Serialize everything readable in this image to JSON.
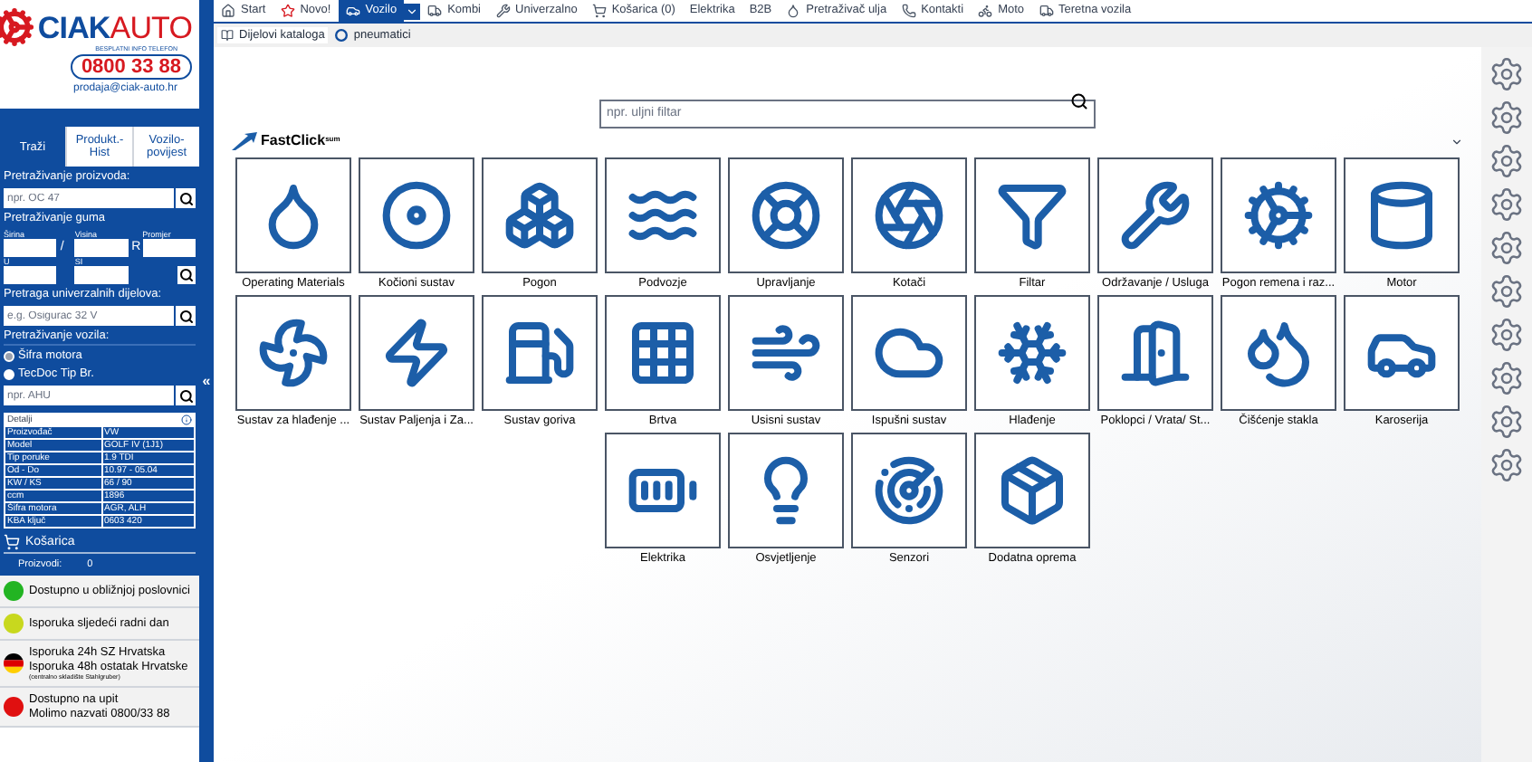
{
  "logo": {
    "brand_bold": "CIAK",
    "brand_light": "AUTO",
    "phone_caption": "BESPLATNI INFO TELEFON",
    "phone": "0800 33 88",
    "email": "prodaja@ciak-auto.hr"
  },
  "sidebar_tabs": [
    {
      "label": "Traži",
      "selected": true
    },
    {
      "label": "Produkt.-Hist",
      "selected": false
    },
    {
      "label": "Vozilo-povijest",
      "selected": false
    }
  ],
  "product_search": {
    "label": "Pretraživanje proizvoda:",
    "placeholder": "npr. OC 47"
  },
  "tyre_search": {
    "label": "Pretraživanje guma",
    "width_label": "Širina",
    "height_label": "Visina",
    "diameter_label": "Promjer",
    "slash": "/",
    "r": "R",
    "u_label": "U",
    "si_label": "SI"
  },
  "universal_search": {
    "label": "Pretraga univerzalnih dijelova:",
    "placeholder": "e.g. Osigurac 32 V"
  },
  "vehicle_search": {
    "label": "Pretraživanje vozila:",
    "options": [
      {
        "label": "Šifra motora",
        "selected": true
      },
      {
        "label": "TecDoc Tip Br.",
        "selected": false
      }
    ],
    "placeholder": "npr. AHU"
  },
  "details": {
    "title": "Detalji",
    "rows": [
      {
        "label": "Proizvođač",
        "value": "VW"
      },
      {
        "label": "Model",
        "value": "GOLF IV (1J1)"
      },
      {
        "label": "Tip poruke",
        "value": "1.9 TDI"
      },
      {
        "label": "Od - Do",
        "value": "10.97 - 05.04"
      },
      {
        "label": "KW / KS",
        "value": "66 / 90"
      },
      {
        "label": "ccm",
        "value": "1896"
      },
      {
        "label": "Šifra motora",
        "value": "AGR, ALH"
      },
      {
        "label": "KBA ključ",
        "value": "0603 420"
      }
    ]
  },
  "cart": {
    "title": "Košarica",
    "products_label": "Proizvodi:",
    "products_count": "0"
  },
  "availability": [
    {
      "color": "#22b422",
      "lines": [
        "Dostupno u obližnjoj poslovnici"
      ]
    },
    {
      "color": "#c8d81e",
      "lines": [
        "Isporuka sljedeći radni dan"
      ]
    },
    {
      "kind": "flag",
      "lines": [
        "Isporuka 24h SZ Hrvatska",
        "Isporuka 48h ostatak Hrvatske"
      ],
      "note": "(centralno skladište Stahlgruber)"
    },
    {
      "color": "#e01010",
      "lines": [
        "Dostupno na upit",
        "Molimo nazvati 0800/33 88"
      ]
    }
  ],
  "collapse_toggle": "«",
  "nav": [
    {
      "label": "Start",
      "selected": false
    },
    {
      "label": "Novo!",
      "selected": false
    },
    {
      "label": "Vozilo",
      "selected": true
    },
    {
      "label": "Kombi",
      "selected": false
    },
    {
      "label": "Univerzalno",
      "selected": false
    },
    {
      "label": "Košarica (0)",
      "selected": false
    },
    {
      "label": "Elektrika",
      "selected": false
    },
    {
      "label": "B2B",
      "selected": false
    },
    {
      "label": "Pretraživač ulja",
      "selected": false
    },
    {
      "label": "Kontakti",
      "selected": false
    },
    {
      "label": "Moto",
      "selected": false
    },
    {
      "label": "Teretna vozila",
      "selected": false
    }
  ],
  "subnav": [
    {
      "label": "Dijelovi kataloga",
      "selected": true
    },
    {
      "label": "pneumatici",
      "selected": false
    }
  ],
  "search": {
    "placeholder": "npr. uljni filtar"
  },
  "fastclick": {
    "name": "FastClick",
    "suffix": "sum"
  },
  "categories": [
    {
      "label": "Operating Materials"
    },
    {
      "label": "Kočioni sustav"
    },
    {
      "label": "Pogon"
    },
    {
      "label": "Podvozje"
    },
    {
      "label": "Upravljanje"
    },
    {
      "label": "Kotači"
    },
    {
      "label": "Filtar"
    },
    {
      "label": "Održavanje / Usluga"
    },
    {
      "label": "Pogon remena i raz..."
    },
    {
      "label": "Motor"
    },
    {
      "label": "Sustav za hlađenje ..."
    },
    {
      "label": "Sustav Paljenja i Za..."
    },
    {
      "label": "Sustav goriva"
    },
    {
      "label": "Brtva"
    },
    {
      "label": "Usisni sustav"
    },
    {
      "label": "Ispušni sustav"
    },
    {
      "label": "Hlađenje"
    },
    {
      "label": "Poklopci / Vrata/ St..."
    },
    {
      "label": "Čišćenje stakla"
    },
    {
      "label": "Karoserija"
    },
    {
      "label": "Elektrika"
    },
    {
      "label": "Osvjetljenje"
    },
    {
      "label": "Senzori"
    },
    {
      "label": "Dodatna oprema"
    }
  ]
}
